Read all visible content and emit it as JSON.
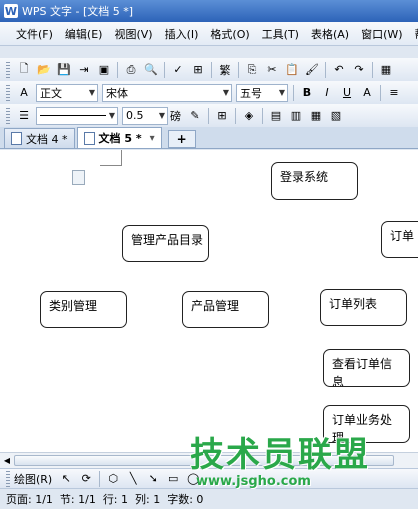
{
  "window": {
    "title": "WPS 文字 - [文档 5 *]",
    "app_icon_letter": "W"
  },
  "menubar": {
    "items": [
      "文件(F)",
      "编辑(E)",
      "视图(V)",
      "插入(I)",
      "格式(O)",
      "工具(T)",
      "表格(A)",
      "窗口(W)",
      "帮"
    ]
  },
  "toolbar_format": {
    "style_value": "正文",
    "font_value": "宋体",
    "size_value": "五号",
    "bold_label": "B",
    "italic_label": "I",
    "underline_label": "U",
    "font_color_label": "A"
  },
  "toolbar_drawing_line": {
    "line_width_value": "0.5",
    "line_unit": "磅"
  },
  "tabs": [
    {
      "label": "文档 4 *",
      "active": false
    },
    {
      "label": "文档 5 *",
      "active": true
    }
  ],
  "tab_add_label": "+",
  "diagram": {
    "nodes": [
      {
        "id": "login",
        "text": "登录系统"
      },
      {
        "id": "manage-products",
        "text": "管理产品目录"
      },
      {
        "id": "orders-partial",
        "text": "订单"
      },
      {
        "id": "category",
        "text": "类别管理"
      },
      {
        "id": "product",
        "text": "产品管理"
      },
      {
        "id": "order-list",
        "text": "订单列表"
      },
      {
        "id": "view-order",
        "text": "查看订单信息"
      },
      {
        "id": "order-business",
        "text": "订单业务处理"
      }
    ]
  },
  "drawbar": {
    "draw_label": "绘图(R)"
  },
  "status": {
    "page": "页面: 1/1",
    "section": "节: 1/1",
    "row": "行: 1",
    "column": "列: 1",
    "word_count": "字数: 0"
  },
  "watermark": {
    "text": "技术员联盟",
    "url": "www.jsgho.com"
  }
}
